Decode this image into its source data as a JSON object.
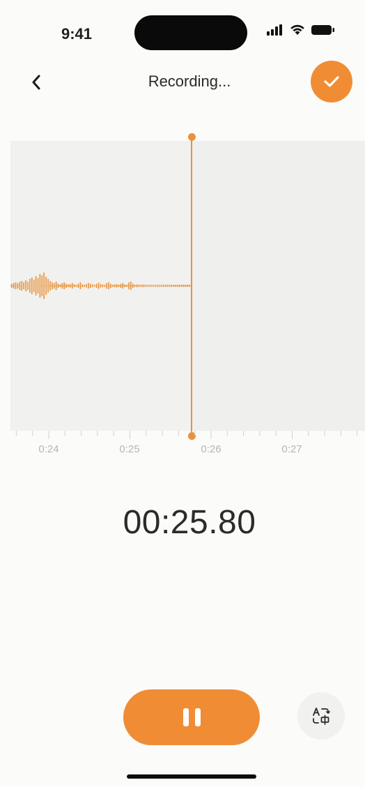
{
  "status_bar": {
    "time": "9:41"
  },
  "header": {
    "title": "Recording..."
  },
  "timeline": {
    "tick_labels": [
      "0:24",
      "0:25",
      "0:26",
      "0:27"
    ],
    "playhead_time": "0:25.80",
    "accent_color": "#e8933c"
  },
  "timer": {
    "elapsed": "00:25.80"
  },
  "controls": {
    "pause_icon": "pause-icon",
    "translate_icon": "translate-icon",
    "done_icon": "check-icon",
    "back_icon": "chevron-left-icon"
  },
  "colors": {
    "accent": "#f08d34",
    "background": "#fbfbf9",
    "panel": "#f1f1ef"
  }
}
